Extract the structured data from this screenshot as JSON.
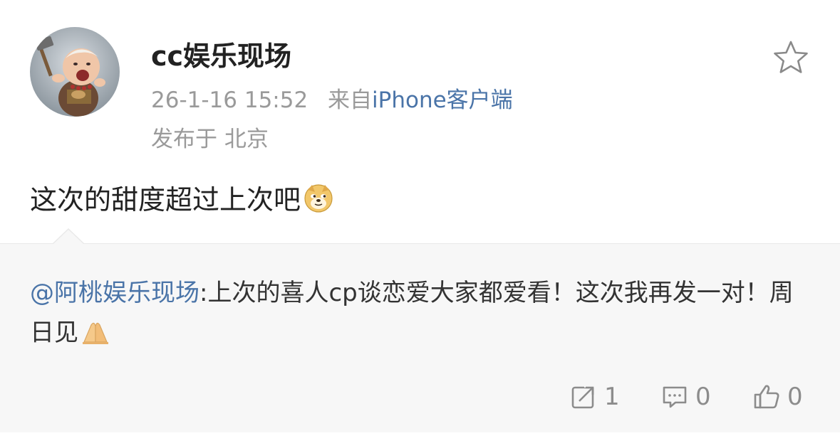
{
  "post": {
    "username": "cc娱乐现场",
    "time": "26-1-16 15:52",
    "source_prefix": "来自",
    "device": "iPhone客户端",
    "location": "发布于 北京",
    "text": "这次的甜度超过上次吧",
    "favorite_icon": "star-outline-icon",
    "emoji": "doge-emoji"
  },
  "repost": {
    "mention": "@阿桃娱乐现场",
    "text": ":上次的喜人cp谈恋爱大家都爱看！这次我再发一对！周日见",
    "emoji": "pray-hands-emoji"
  },
  "actions": {
    "repost_count": "1",
    "comment_count": "0",
    "like_count": "0"
  },
  "colors": {
    "link": "#4a74a8",
    "meta": "#9a9a9a",
    "repost_bg": "#f7f7f7"
  }
}
